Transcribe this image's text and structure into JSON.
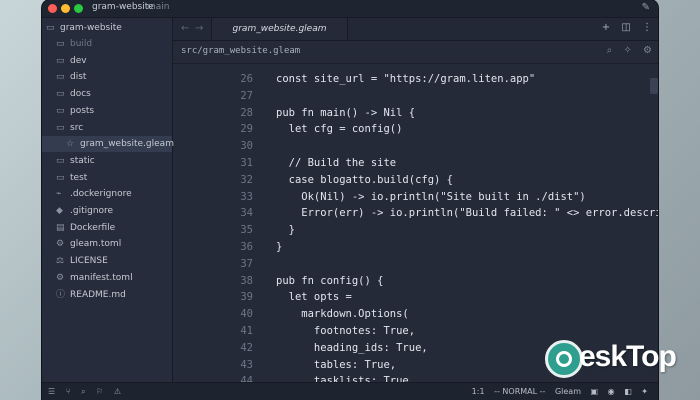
{
  "window": {
    "title": "gram-website",
    "branch": "main",
    "edit_icon": "✎"
  },
  "sidebar": {
    "root": "gram-website",
    "items": [
      {
        "label": "build",
        "icon": "folder-icon",
        "dim": true
      },
      {
        "label": "dev",
        "icon": "folder-icon"
      },
      {
        "label": "dist",
        "icon": "folder-icon"
      },
      {
        "label": "docs",
        "icon": "folder-icon"
      },
      {
        "label": "posts",
        "icon": "folder-icon"
      },
      {
        "label": "src",
        "icon": "folder-open-icon"
      },
      {
        "label": "gram_website.gleam",
        "icon": "gleam-file-icon",
        "selected": true,
        "indent": true
      },
      {
        "label": "static",
        "icon": "folder-icon"
      },
      {
        "label": "test",
        "icon": "folder-icon"
      },
      {
        "label": ".dockerignore",
        "icon": "file-icon"
      },
      {
        "label": ".gitignore",
        "icon": "git-icon"
      },
      {
        "label": "Dockerfile",
        "icon": "docker-icon"
      },
      {
        "label": "gleam.toml",
        "icon": "gear-file-icon"
      },
      {
        "label": "LICENSE",
        "icon": "license-icon"
      },
      {
        "label": "manifest.toml",
        "icon": "gear-file-icon"
      },
      {
        "label": "README.md",
        "icon": "info-icon"
      }
    ]
  },
  "tabs": {
    "active": "gram_website.gleam"
  },
  "breadcrumb": "src/gram_website.gleam",
  "code_lines": [
    {
      "n": "26",
      "text": "const site_url = \"https://gram.liten.app\""
    },
    {
      "n": "27",
      "text": ""
    },
    {
      "n": "28",
      "text": "pub fn main() -> Nil {"
    },
    {
      "n": "29",
      "text": "  let cfg = config()"
    },
    {
      "n": "30",
      "text": ""
    },
    {
      "n": "31",
      "text": "  // Build the site"
    },
    {
      "n": "32",
      "text": "  case blogatto.build(cfg) {"
    },
    {
      "n": "33",
      "text": "    Ok(Nil) -> io.println(\"Site built in ./dist\")"
    },
    {
      "n": "34",
      "text": "    Error(err) -> io.println(\"Build failed: \" <> error.describe_error"
    },
    {
      "n": "35",
      "text": "  }"
    },
    {
      "n": "36",
      "text": "}"
    },
    {
      "n": "37",
      "text": ""
    },
    {
      "n": "38",
      "text": "pub fn config() {"
    },
    {
      "n": "39",
      "text": "  let opts ="
    },
    {
      "n": "40",
      "text": "    markdown.Options("
    },
    {
      "n": "41",
      "text": "      footnotes: True,"
    },
    {
      "n": "42",
      "text": "      heading_ids: True,"
    },
    {
      "n": "43",
      "text": "      tables: True,"
    },
    {
      "n": "44",
      "text": "      tasklists: True,"
    }
  ],
  "statusbar": {
    "position": "1:1",
    "mode": "-- NORMAL --",
    "language": "Gleam"
  },
  "watermark": {
    "text": "eskTop"
  }
}
